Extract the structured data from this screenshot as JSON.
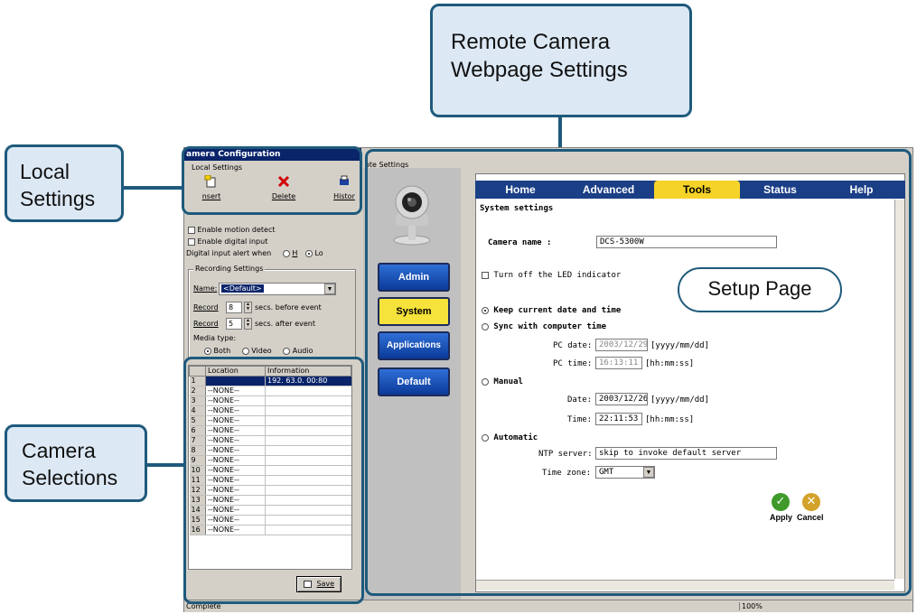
{
  "callouts": {
    "remote": [
      "Remote Camera",
      "Webpage Settings"
    ],
    "local": [
      "Local",
      "Settings"
    ],
    "camera": [
      "Camera",
      "Selections"
    ],
    "setup": "Setup Page"
  },
  "window": {
    "title": "amera Configuration",
    "local_settings_label": "Local Settings",
    "toolbar": {
      "insert": "nsert",
      "delete": "Delete",
      "history": "Histor"
    },
    "remote_tab_label": "ote Settings",
    "status_left": "Complete",
    "status_right": "100%"
  },
  "local": {
    "motion": "Enable motion detect",
    "digital_input": "Enable digital input",
    "alert_when": "Digital input alert when",
    "high": "H",
    "low": "Lo",
    "recording_title": "Recording Settings",
    "name_label": "Name:",
    "name_value": "<Default>",
    "record_label": "Record",
    "before_value": "8",
    "before_text": "secs. before event",
    "after_value": "5",
    "after_text": "secs. after event",
    "media_label": "Media type:",
    "media_options": [
      "Both",
      "Video",
      "Audio"
    ],
    "grid_headers": [
      "",
      "Location",
      "Information"
    ],
    "grid_rows": [
      {
        "n": "1",
        "loc": "",
        "info": "192. 63.0. 00:80"
      },
      {
        "n": "2",
        "loc": "--NONE--",
        "info": ""
      },
      {
        "n": "3",
        "loc": "--NONE--",
        "info": ""
      },
      {
        "n": "4",
        "loc": "--NONE--",
        "info": ""
      },
      {
        "n": "5",
        "loc": "--NONE--",
        "info": ""
      },
      {
        "n": "6",
        "loc": "--NONE--",
        "info": ""
      },
      {
        "n": "7",
        "loc": "--NONE--",
        "info": ""
      },
      {
        "n": "8",
        "loc": "--NONE--",
        "info": ""
      },
      {
        "n": "9",
        "loc": "--NONE--",
        "info": ""
      },
      {
        "n": "10",
        "loc": "--NONE--",
        "info": ""
      },
      {
        "n": "11",
        "loc": "--NONE--",
        "info": ""
      },
      {
        "n": "12",
        "loc": "--NONE--",
        "info": ""
      },
      {
        "n": "13",
        "loc": "--NONE--",
        "info": ""
      },
      {
        "n": "14",
        "loc": "--NONE--",
        "info": ""
      },
      {
        "n": "15",
        "loc": "--NONE--",
        "info": ""
      },
      {
        "n": "16",
        "loc": "--NONE--",
        "info": ""
      }
    ],
    "save": "Save"
  },
  "remote": {
    "nav": [
      "Admin",
      "System",
      "Applications",
      "Default"
    ],
    "tabs": [
      "Home",
      "Advanced",
      "Tools",
      "Status",
      "Help"
    ],
    "section_title": "System settings",
    "camera_name_label": "Camera name :",
    "camera_name_value": "DCS-5300W",
    "led_label": "Turn off the LED indicator",
    "keep_label": "Keep current date and time",
    "sync_label": "Sync with computer time",
    "pc_date_label": "PC date:",
    "pc_date_value": "2003/12/29",
    "pc_date_fmt": "[yyyy/mm/dd]",
    "pc_time_label": "PC time:",
    "pc_time_value": "16:13:11",
    "pc_time_fmt": "[hh:mm:ss]",
    "manual_label": "Manual",
    "date_label": "Date:",
    "date_value": "2003/12/26",
    "date_fmt": "[yyyy/mm/dd]",
    "time_label": "Time:",
    "time_value": "22:11:53",
    "time_fmt": "[hh:mm:ss]",
    "automatic_label": "Automatic",
    "ntp_label": "NTP server:",
    "ntp_value": "skip to invoke default server",
    "tz_label": "Time zone:",
    "tz_value": "GMT",
    "apply": "Apply",
    "cancel": "Cancel"
  },
  "colors": {
    "callout_border": "#1f5a7c",
    "callout_fill": "#dce8f4",
    "tab_bar": "#1b3f86",
    "tab_active": "#f6d329"
  }
}
